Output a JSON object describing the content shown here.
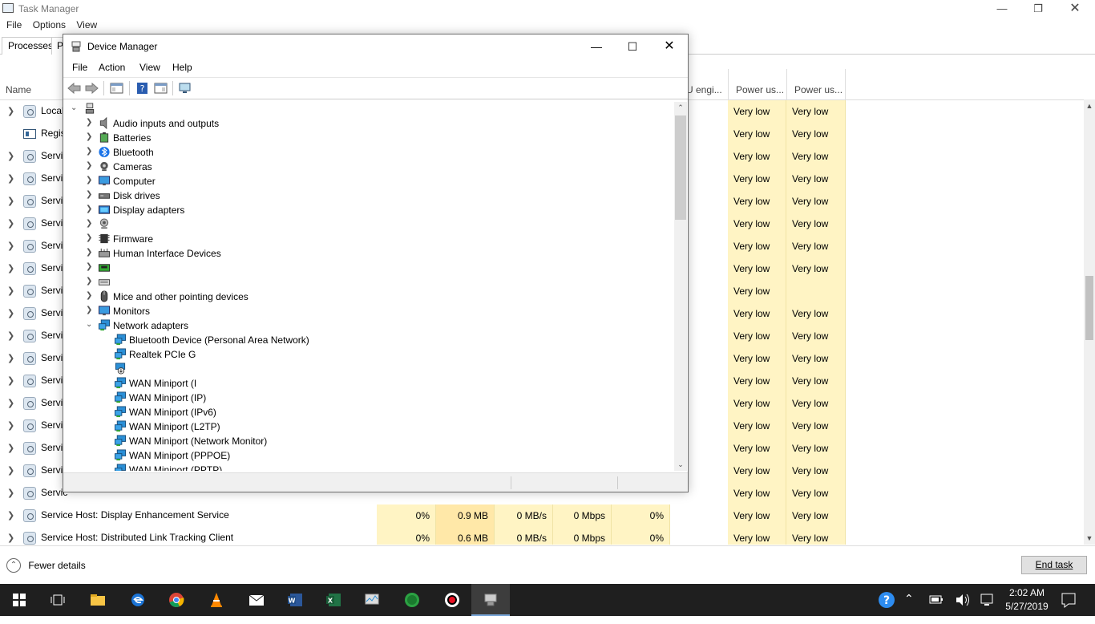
{
  "task_manager": {
    "title": "Task Manager",
    "menu": [
      "File",
      "Options",
      "View"
    ],
    "tabs": {
      "processes": "Processes",
      "partial": "P"
    },
    "columns": {
      "name": "Name",
      "gpu_engine": "U engi...",
      "power_usage": "Power us...",
      "power_trend": "Power us..."
    },
    "rows": [
      {
        "name": "Local",
        "power": "Very low",
        "trend": "Very low",
        "icon": "gear-icon",
        "expandable": true
      },
      {
        "name": "Regis",
        "power": "Very low",
        "trend": "Very low",
        "icon": "registry-icon",
        "expandable": false
      },
      {
        "name": "Servic",
        "power": "Very low",
        "trend": "Very low",
        "icon": "gear-icon",
        "expandable": true
      },
      {
        "name": "Servic",
        "power": "Very low",
        "trend": "Very low",
        "icon": "gear-icon",
        "expandable": true
      },
      {
        "name": "Servic",
        "power": "Very low",
        "trend": "Very low",
        "icon": "gear-icon",
        "expandable": true
      },
      {
        "name": "Servic",
        "power": "Very low",
        "trend": "Very low",
        "icon": "gear-icon",
        "expandable": true
      },
      {
        "name": "Servic",
        "power": "Very low",
        "trend": "Very low",
        "icon": "gear-icon",
        "expandable": true
      },
      {
        "name": "Servic",
        "power": "Very low",
        "trend": "Very low",
        "icon": "gear-icon",
        "expandable": true
      },
      {
        "name": "Servic",
        "power": "Very low",
        "trend": "",
        "icon": "gear-icon",
        "expandable": true
      },
      {
        "name": "Servic",
        "power": "Very low",
        "trend": "Very low",
        "icon": "gear-icon",
        "expandable": true
      },
      {
        "name": "Servic",
        "power": "Very low",
        "trend": "Very low",
        "icon": "gear-icon",
        "expandable": true
      },
      {
        "name": "Servic",
        "power": "Very low",
        "trend": "Very low",
        "icon": "gear-icon",
        "expandable": true
      },
      {
        "name": "Servic",
        "power": "Very low",
        "trend": "Very low",
        "icon": "gear-icon",
        "expandable": true
      },
      {
        "name": "Servic",
        "power": "Very low",
        "trend": "Very low",
        "icon": "gear-icon",
        "expandable": true
      },
      {
        "name": "Servic",
        "power": "Very low",
        "trend": "Very low",
        "icon": "gear-icon",
        "expandable": true
      },
      {
        "name": "Servic",
        "power": "Very low",
        "trend": "Very low",
        "icon": "gear-icon",
        "expandable": true
      },
      {
        "name": "Servic",
        "power": "Very low",
        "trend": "Very low",
        "icon": "gear-icon",
        "expandable": true
      },
      {
        "name": "Servic",
        "power": "Very low",
        "trend": "Very low",
        "icon": "gear-icon",
        "expandable": true
      },
      {
        "name": "Service Host: Display Enhancement Service",
        "cpu": "0%",
        "memory": "0.9 MB",
        "disk": "0 MB/s",
        "network": "0 Mbps",
        "gpu": "0%",
        "power": "Very low",
        "trend": "Very low",
        "icon": "gear-icon",
        "expandable": true
      },
      {
        "name": "Service Host: Distributed Link Tracking Client",
        "cpu": "0%",
        "memory": "0.6 MB",
        "disk": "0 MB/s",
        "network": "0 Mbps",
        "gpu": "0%",
        "power": "Very low",
        "trend": "Very low",
        "icon": "gear-icon",
        "expandable": true
      }
    ],
    "footer": {
      "fewer_details": "Fewer details",
      "end_task": "End task"
    }
  },
  "device_manager": {
    "title": "Device Manager",
    "menu": [
      "File",
      "Action",
      "View",
      "Help"
    ],
    "tree": [
      {
        "label": "",
        "level": 0,
        "expand": "open",
        "icon": "computer-root-icon"
      },
      {
        "label": "Audio inputs and outputs",
        "level": 1,
        "expand": "closed",
        "icon": "speaker-icon"
      },
      {
        "label": "Batteries",
        "level": 1,
        "expand": "closed",
        "icon": "battery-icon"
      },
      {
        "label": "Bluetooth",
        "level": 1,
        "expand": "closed",
        "icon": "bluetooth-icon"
      },
      {
        "label": "Cameras",
        "level": 1,
        "expand": "closed",
        "icon": "camera-icon"
      },
      {
        "label": "Computer",
        "level": 1,
        "expand": "closed",
        "icon": "monitor-icon"
      },
      {
        "label": "Disk drives",
        "level": 1,
        "expand": "closed",
        "icon": "disk-drive-icon"
      },
      {
        "label": "Display adapters",
        "level": 1,
        "expand": "closed",
        "icon": "display-adapter-icon"
      },
      {
        "label": "",
        "level": 1,
        "expand": "closed",
        "icon": "webcam-icon"
      },
      {
        "label": "Firmware",
        "level": 1,
        "expand": "closed",
        "icon": "firmware-chip-icon"
      },
      {
        "label": "Human Interface Devices",
        "level": 1,
        "expand": "closed",
        "icon": "hid-icon"
      },
      {
        "label": "",
        "level": 1,
        "expand": "closed",
        "icon": "ide-controller-icon"
      },
      {
        "label": "",
        "level": 1,
        "expand": "closed",
        "icon": "keyboard-icon"
      },
      {
        "label": "Mice and other pointing devices",
        "level": 1,
        "expand": "closed",
        "icon": "mouse-icon"
      },
      {
        "label": "Monitors",
        "level": 1,
        "expand": "closed",
        "icon": "monitor-icon"
      },
      {
        "label": "Network adapters",
        "level": 1,
        "expand": "open",
        "icon": "network-adapter-icon"
      },
      {
        "label": "Bluetooth Device (Personal Area Network)",
        "level": 2,
        "expand": "none",
        "icon": "network-adapter-icon"
      },
      {
        "label": "Realtek PCIe G",
        "level": 2,
        "expand": "none",
        "icon": "network-adapter-icon"
      },
      {
        "label": "",
        "level": 2,
        "expand": "none",
        "icon": "network-adapter-download-icon"
      },
      {
        "label": "WAN Miniport (I",
        "level": 2,
        "expand": "none",
        "icon": "network-adapter-icon"
      },
      {
        "label": "WAN Miniport (IP)",
        "level": 2,
        "expand": "none",
        "icon": "network-adapter-icon"
      },
      {
        "label": "WAN Miniport (IPv6)",
        "level": 2,
        "expand": "none",
        "icon": "network-adapter-icon"
      },
      {
        "label": "WAN Miniport (L2TP)",
        "level": 2,
        "expand": "none",
        "icon": "network-adapter-icon"
      },
      {
        "label": "WAN Miniport (Network Monitor)",
        "level": 2,
        "expand": "none",
        "icon": "network-adapter-icon"
      },
      {
        "label": "WAN Miniport (PPPOE)",
        "level": 2,
        "expand": "none",
        "icon": "network-adapter-icon"
      },
      {
        "label": "WAN Miniport (PPTP)",
        "level": 2,
        "expand": "none",
        "icon": "network-adapter-icon"
      }
    ]
  },
  "taskbar": {
    "apps": [
      "start-icon",
      "task-view-icon",
      "file-explorer-icon",
      "edge-icon",
      "chrome-icon",
      "vlc-icon",
      "mail-icon",
      "word-icon",
      "excel-icon",
      "monitor-app-icon",
      "xbox-icon",
      "record-icon",
      "device-manager-icon"
    ],
    "clock": {
      "time": "2:02 AM",
      "date": "5/27/2019"
    }
  },
  "colors": {
    "highlight_yellow": "#fff4c4",
    "memory_yellow": "#ffe8a8",
    "taskbar_bg": "#1f1f1f",
    "adapter_blue": "#2b8fd6"
  }
}
